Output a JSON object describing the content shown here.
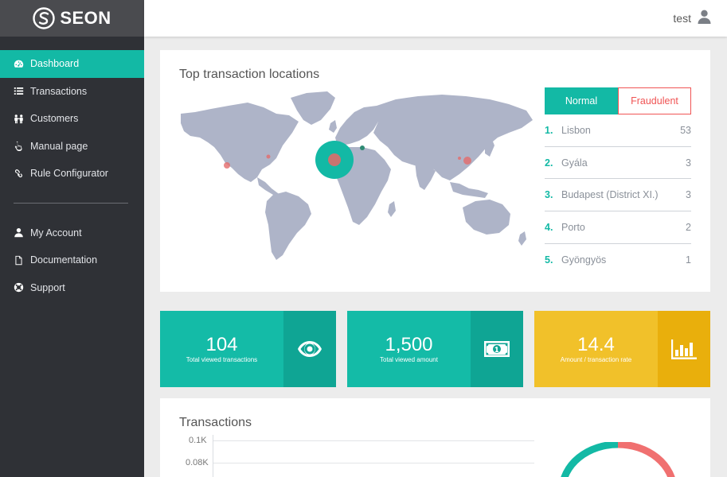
{
  "app": {
    "logo_text": "SEON"
  },
  "sidebar": {
    "items": [
      {
        "label": "Dashboard",
        "icon": "dashboard-icon",
        "active": true
      },
      {
        "label": "Transactions",
        "icon": "list-icon",
        "active": false
      },
      {
        "label": "Customers",
        "icon": "users-icon",
        "active": false
      },
      {
        "label": "Manual page",
        "icon": "hand-pointer-icon",
        "active": false
      },
      {
        "label": "Rule Configurator",
        "icon": "link-icon",
        "active": false
      }
    ],
    "secondary": [
      {
        "label": "My Account",
        "icon": "user-icon"
      },
      {
        "label": "Documentation",
        "icon": "document-icon"
      },
      {
        "label": "Support",
        "icon": "lifebuoy-icon"
      }
    ]
  },
  "header": {
    "username": "test"
  },
  "map_card": {
    "title": "Top transaction locations",
    "toggle": {
      "normal": "Normal",
      "fraudulent": "Fraudulent",
      "selected": "Normal"
    },
    "locations": [
      {
        "rank": "1.",
        "name": "Lisbon",
        "count": "53"
      },
      {
        "rank": "2.",
        "name": "Gyála",
        "count": "3"
      },
      {
        "rank": "3.",
        "name": "Budapest (District XI.)",
        "count": "3"
      },
      {
        "rank": "4.",
        "name": "Porto",
        "count": "2"
      },
      {
        "rank": "5.",
        "name": "Gyöngyös",
        "count": "1"
      }
    ]
  },
  "stats": [
    {
      "value": "104",
      "label": "Total viewed transactions",
      "icon": "eye-icon",
      "color": "#14bba7"
    },
    {
      "value": "1,500",
      "label": "Total viewed amount",
      "icon": "money-icon",
      "color": "#14bba7"
    },
    {
      "value": "14.4",
      "label": "Amount / transaction rate",
      "icon": "bar-chart-icon",
      "color": "#f1c12a"
    }
  ],
  "transactions_card": {
    "title": "Transactions",
    "y_ticks": [
      "0.1K",
      "0.08K"
    ]
  },
  "colors": {
    "accent": "#13b9a5",
    "fraud": "#f05454",
    "sidebar": "#2f3136"
  }
}
